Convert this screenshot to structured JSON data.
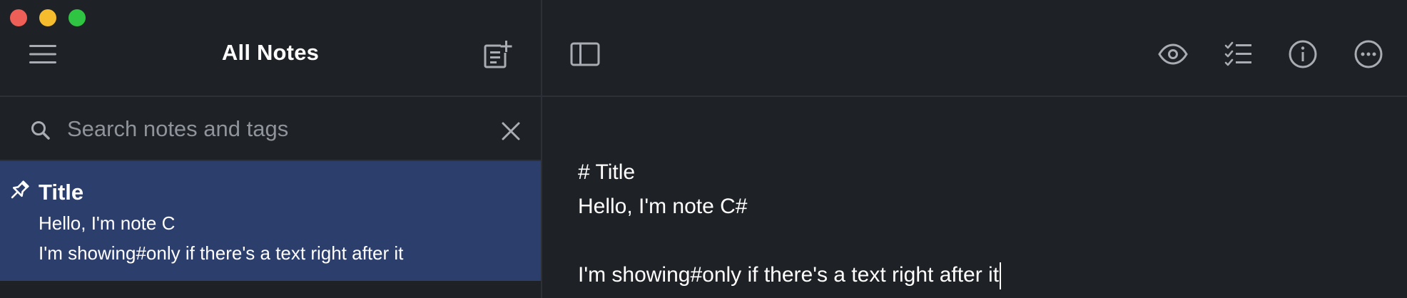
{
  "window": {
    "traffic_lights": {
      "close_color": "#ee5f57",
      "minimize_color": "#f5bd2e",
      "maximize_color": "#2fc441"
    }
  },
  "sidebar": {
    "title": "All Notes",
    "menu_icon": "hamburger-menu-icon",
    "new_note_icon": "new-note-icon",
    "search": {
      "placeholder": "Search notes and tags",
      "value": "",
      "search_icon": "search-icon",
      "clear_icon": "close-icon"
    },
    "notes": [
      {
        "pinned": true,
        "title": "Title",
        "lines": [
          "Hello, I'm note C",
          "I'm showing#only if there's a text right after it"
        ],
        "selected": true
      }
    ],
    "selected_color": "#2c3e6c"
  },
  "toolbar": {
    "sidebar_toggle_icon": "sidebar-toggle-icon",
    "preview_icon": "eye-icon",
    "checklist_icon": "checklist-icon",
    "info_icon": "info-icon",
    "more_icon": "more-icon"
  },
  "editor": {
    "lines": [
      "# Title",
      "Hello, I'm note C#",
      "",
      "I'm showing#only if there's a text right after it"
    ]
  },
  "colors": {
    "background": "#1e2126",
    "divider": "#2d3036",
    "text": "#ffffff",
    "placeholder": "#8f939a",
    "icon": "#a9adb3"
  }
}
